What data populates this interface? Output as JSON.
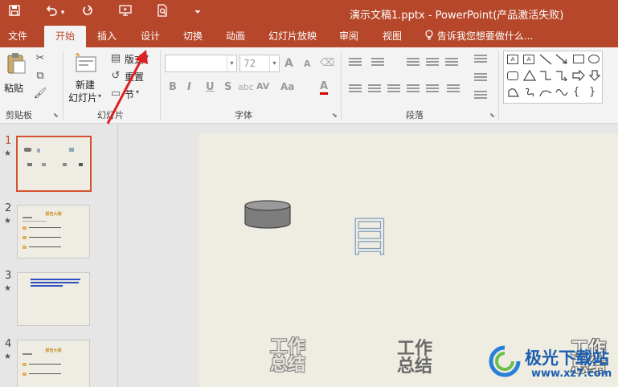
{
  "titlebar": {
    "title": "演示文稿1.pptx - PowerPoint(产品激活失败)",
    "icons": [
      "save-icon",
      "undo-icon",
      "undo-dropdown-icon",
      "redo-icon",
      "slideshow-from-start-icon",
      "print-preview-icon",
      "customize-qat-icon"
    ]
  },
  "tabs": [
    {
      "label": "文件",
      "active": false
    },
    {
      "label": "开始",
      "active": true
    },
    {
      "label": "插入",
      "active": false
    },
    {
      "label": "设计",
      "active": false
    },
    {
      "label": "切换",
      "active": false
    },
    {
      "label": "动画",
      "active": false
    },
    {
      "label": "幻灯片放映",
      "active": false
    },
    {
      "label": "审阅",
      "active": false
    },
    {
      "label": "视图",
      "active": false
    }
  ],
  "tell_me": "告诉我您想要做什么...",
  "ribbon": {
    "clipboard": {
      "paste_label": "粘贴",
      "group_label": "剪贴板"
    },
    "slides": {
      "new_slide_line1": "新建",
      "new_slide_line2": "幻灯片",
      "layout_label": "版式",
      "reset_label": "重置",
      "section_label": "节",
      "group_label": "幻灯片"
    },
    "font": {
      "font_name": "",
      "font_size": "72",
      "group_label": "字体",
      "bold": "B",
      "italic": "I",
      "underline": "U",
      "shadow": "S",
      "spacing": "AV",
      "case": "Aa",
      "color": "A",
      "grow": "A",
      "shrink": "A"
    },
    "paragraph": {
      "group_label": "段落"
    }
  },
  "slides_panel": [
    {
      "number": "1",
      "selected": true
    },
    {
      "number": "2",
      "selected": false
    },
    {
      "number": "3",
      "selected": false
    },
    {
      "number": "4",
      "selected": false
    }
  ],
  "thumbnail_texts": {
    "slide2_title": "报告大纲",
    "slide4_title": "报告大纲"
  },
  "slide": {
    "big_char": "目",
    "wordart": [
      "工作总结",
      "工作总结",
      "工作总结"
    ]
  },
  "watermark": {
    "brand": "极光下载站",
    "url": "www.xz7.com"
  },
  "colors": {
    "accent": "#b7472a",
    "selection": "#d35230",
    "slide_bg": "#efece2"
  }
}
